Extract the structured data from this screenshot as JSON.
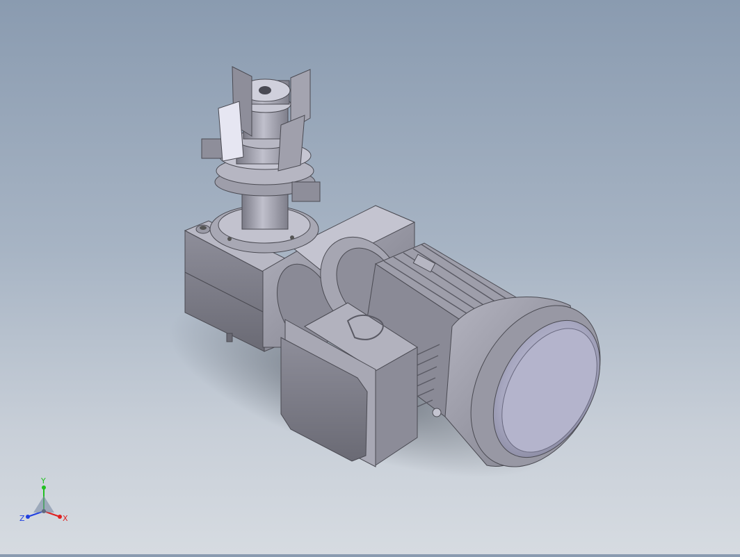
{
  "viewport": {
    "background_top": "#8a9bb0",
    "background_bottom": "#d6dbe1"
  },
  "model": {
    "parts": [
      "output-coupling",
      "flange",
      "gearbox-housing",
      "motor-adapter",
      "terminal-box",
      "motor-body",
      "fan-cover",
      "cooling-fins"
    ],
    "body_color": "#9a9aa6",
    "highlight_color": "#d2d2e0",
    "shadow_color": "#5e5e68"
  },
  "triad": {
    "x_label": "X",
    "y_label": "Y",
    "z_label": "Z",
    "x_color": "#e02020",
    "y_color": "#20c020",
    "z_color": "#2040e0"
  }
}
